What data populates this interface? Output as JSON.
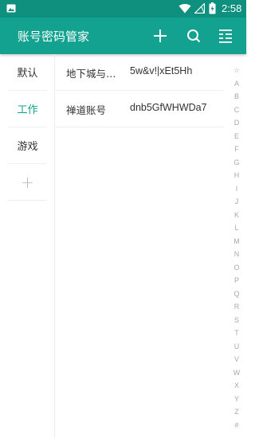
{
  "status_bar": {
    "time": "2:58",
    "icons": [
      "image-icon",
      "wifi-icon",
      "signal-icon",
      "battery-icon"
    ]
  },
  "app_bar": {
    "title": "账号密码管家",
    "actions": [
      "add-icon",
      "search-icon",
      "menu-icon"
    ]
  },
  "categories": [
    {
      "label": "默认",
      "active": false
    },
    {
      "label": "工作",
      "active": true
    },
    {
      "label": "游戏",
      "active": false
    }
  ],
  "add_category_label": "+",
  "accounts": [
    {
      "name": "地下城与勇士",
      "password": "5w&v!|xEt5Hh"
    },
    {
      "name": "禅道账号",
      "password": "dnb5GfWHWDa7"
    }
  ],
  "index_letters": [
    "☆",
    "A",
    "B",
    "C",
    "D",
    "E",
    "F",
    "G",
    "H",
    "I",
    "J",
    "K",
    "L",
    "M",
    "N",
    "O",
    "P",
    "Q",
    "R",
    "S",
    "T",
    "U",
    "V",
    "W",
    "X",
    "Y",
    "Z",
    "#"
  ],
  "colors": {
    "status_bar": "#0f8f7e",
    "app_bar": "#12a28f",
    "accent": "#12a28f"
  }
}
